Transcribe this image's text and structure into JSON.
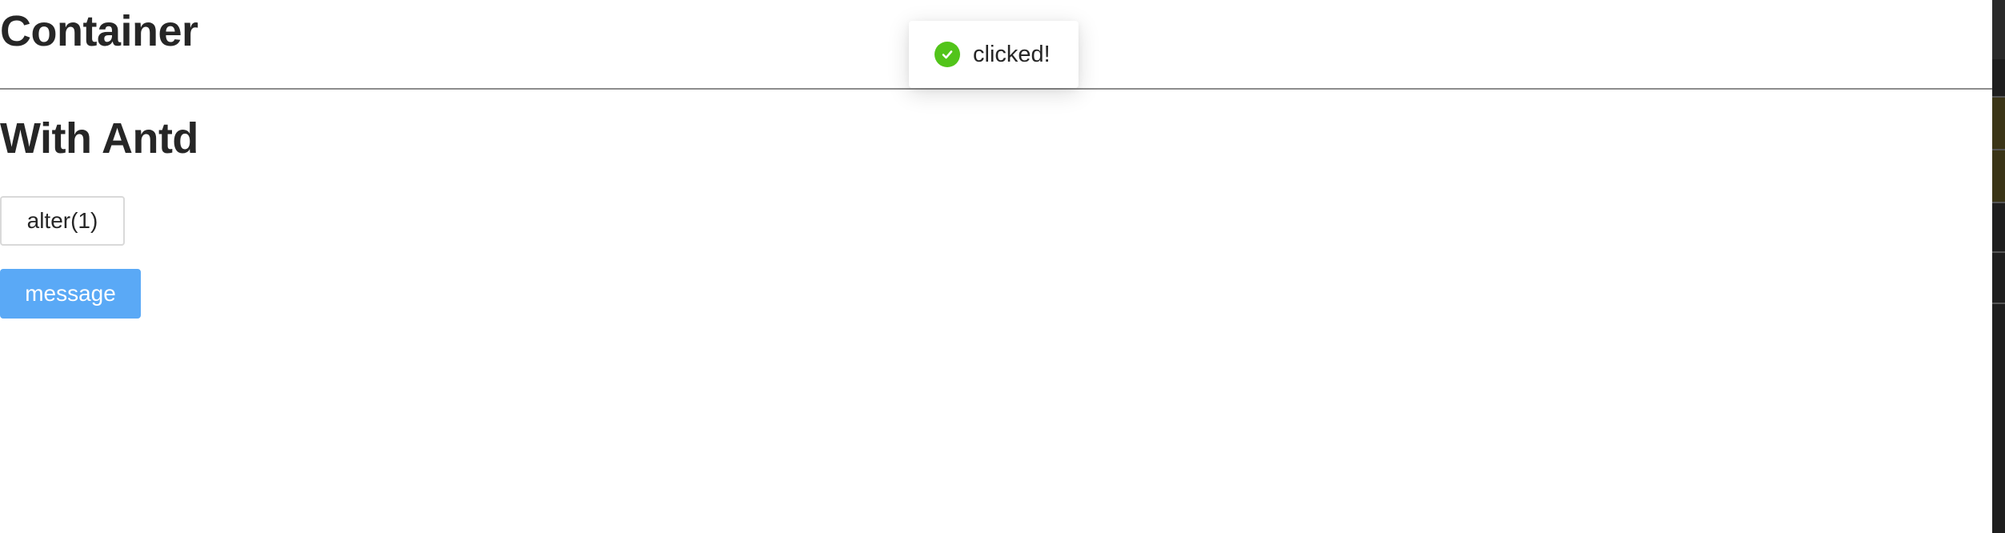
{
  "page": {
    "heading_container": "Container",
    "heading_antd": "With Antd"
  },
  "buttons": {
    "alter_label": "alter(1)",
    "message_label": "message"
  },
  "toast": {
    "text": "clicked!",
    "icon": "check-circle-icon",
    "icon_color": "#52c41a"
  },
  "colors": {
    "primary_button": "#5aa9f6",
    "divider": "#8c8c8c",
    "text": "#262626"
  }
}
